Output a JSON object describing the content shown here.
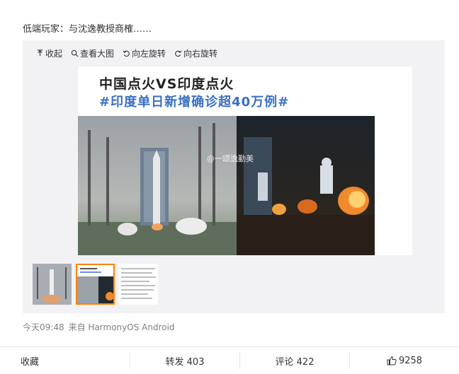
{
  "post": {
    "text": "低端玩家：与沈逸教授商榷……"
  },
  "toolbar": {
    "collapse_label": "收起",
    "view_large_label": "查看大图",
    "rotate_left_label": "向左旋转",
    "rotate_right_label": "向右旋转"
  },
  "image": {
    "title_line1": "中国点火VS印度点火",
    "title_line2": "#印度单日新增确诊超40万例#",
    "watermark": "@一颂逸勤美"
  },
  "thumbnails": {
    "count_selected": 2
  },
  "meta": {
    "time": "今天09:48",
    "source": "来自 HarmonyOS Android"
  },
  "footer": {
    "favorite_label": "收藏",
    "repost_label": "转发 403",
    "comment_label": "评论 422",
    "like_count": "9258"
  },
  "colors": {
    "accent": "#ff8200",
    "title_blue": "#3a6fc4",
    "meta_gray": "#808080"
  }
}
